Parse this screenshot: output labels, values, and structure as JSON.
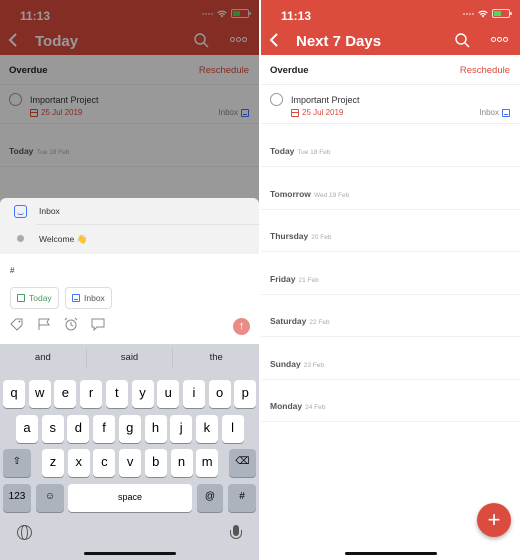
{
  "status_bar": {
    "time": "11:13"
  },
  "colors": {
    "brand": "#db4c3f",
    "project_inbox": "#4073ff",
    "today_green": "#4a9a5c"
  },
  "left": {
    "header": {
      "title": "Today"
    },
    "overdue": {
      "label": "Overdue",
      "action": "Reschedule"
    },
    "task": {
      "name": "Important Project",
      "date": "25 Jul 2019",
      "project": "Inbox"
    },
    "today_section": {
      "label": "Today",
      "date": "Tue 18 Feb"
    },
    "suggestions": [
      {
        "label": "Inbox",
        "icon": "inbox-icon"
      },
      {
        "label": "Welcome 👋",
        "icon": "dot-icon"
      }
    ],
    "composer": {
      "input_value": "#",
      "chips": [
        {
          "label": "Today",
          "icon": "calendar-icon"
        },
        {
          "label": "Inbox",
          "icon": "inbox-icon"
        }
      ],
      "tools": [
        "label-icon",
        "flag-icon",
        "alarm-icon",
        "comment-icon"
      ],
      "send_icon": "↑"
    },
    "keyboard": {
      "predictions": [
        "and",
        "said",
        "the"
      ],
      "row1": [
        "q",
        "w",
        "e",
        "r",
        "t",
        "y",
        "u",
        "i",
        "o",
        "p"
      ],
      "row2": [
        "a",
        "s",
        "d",
        "f",
        "g",
        "h",
        "j",
        "k",
        "l"
      ],
      "row3": [
        "z",
        "x",
        "c",
        "v",
        "b",
        "n",
        "m"
      ],
      "shift": "⇧",
      "backspace": "⌫",
      "numbers": "123",
      "emoji": "☺",
      "space": "space",
      "at": "@",
      "hash": "#"
    }
  },
  "right": {
    "header": {
      "title": "Next 7 Days"
    },
    "overdue": {
      "label": "Overdue",
      "action": "Reschedule"
    },
    "task": {
      "name": "Important Project",
      "date": "25 Jul 2019",
      "project": "Inbox"
    },
    "days": [
      {
        "name": "Today",
        "date": "Tue 18 Feb"
      },
      {
        "name": "Tomorrow",
        "date": "Wed 19 Feb"
      },
      {
        "name": "Thursday",
        "date": "20 Feb"
      },
      {
        "name": "Friday",
        "date": "21 Feb"
      },
      {
        "name": "Saturday",
        "date": "22 Feb"
      },
      {
        "name": "Sunday",
        "date": "23 Feb"
      },
      {
        "name": "Monday",
        "date": "24 Feb"
      }
    ],
    "fab": "+"
  }
}
